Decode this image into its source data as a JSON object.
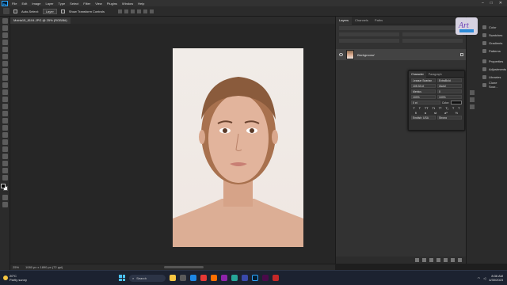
{
  "menubar": {
    "app_icon": "Ps",
    "items": [
      "File",
      "Edit",
      "Image",
      "Layer",
      "Type",
      "Select",
      "Filter",
      "View",
      "Plugins",
      "Window",
      "Help"
    ]
  },
  "options_bar": {
    "auto_select_label": "Auto-Select:",
    "auto_select_value": "Layer",
    "transform_label": "Show Transform Controls"
  },
  "document": {
    "tab_title": "Moiria15_8104.JPG @ 25% (RGB/8#)",
    "zoom": "25%",
    "doc_info": "1080 px x 1890 px (72 ppi)"
  },
  "layers_panel": {
    "tabs": [
      "Layers",
      "Channels",
      "Paths"
    ],
    "layer_name": "Background"
  },
  "character_panel": {
    "tabs": [
      "Character",
      "Paragraph"
    ],
    "font_family": "League Spartan",
    "font_style": "ExtraBold",
    "font_size": "105.33 pt",
    "leading": "(Auto)",
    "kerning": "Metrics",
    "tracking": "0",
    "vscale": "100%",
    "hscale": "100%",
    "baseline": "0 pt",
    "color_label": "Color:",
    "language": "English: USA",
    "antialias": "Strong"
  },
  "dock": {
    "group1": [
      "Color",
      "Swatches",
      "Gradients",
      "Patterns"
    ],
    "group2": [
      "Properties",
      "Adjustments",
      "Libraries",
      "Clone Sour..."
    ]
  },
  "taskbar": {
    "temperature": "20°C",
    "weather": "Partly sunny",
    "search_label": "Search",
    "time": "8:36 AM",
    "date": "4/30/2023"
  },
  "colors": {
    "ps_blue": "#31a8ff",
    "panel_bg": "#323232",
    "canvas_bg": "#262626",
    "taskbar_bg": "#1c2230"
  }
}
